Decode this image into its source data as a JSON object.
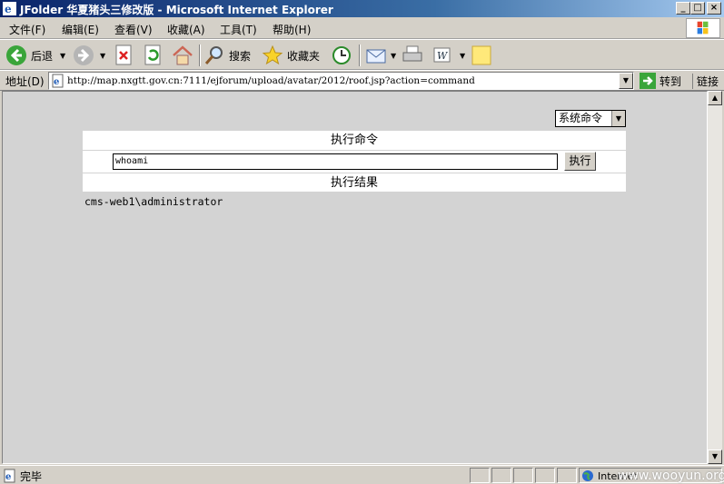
{
  "window": {
    "title": "JFolder 华夏猪头三修改版 - Microsoft Internet Explorer"
  },
  "menu": [
    "文件(F)",
    "编辑(E)",
    "查看(V)",
    "收藏(A)",
    "工具(T)",
    "帮助(H)"
  ],
  "toolbar": {
    "back": "后退",
    "search": "搜索",
    "favorites": "收藏夹"
  },
  "address": {
    "label": "地址(D)",
    "url": "http://map.nxgtt.gov.cn:7111/ejforum/upload/avatar/2012/roof.jsp?action=command",
    "go": "转到",
    "links": "链接"
  },
  "page": {
    "select_value": "系统命令",
    "header_exec": "执行命令",
    "command_value": "whoami",
    "exec_button": "执行",
    "header_result": "执行结果",
    "result_text": "cms-web1\\administrator"
  },
  "status": {
    "text": "完毕",
    "zone": "Internet",
    "watermark": "www.wooyun.org"
  }
}
